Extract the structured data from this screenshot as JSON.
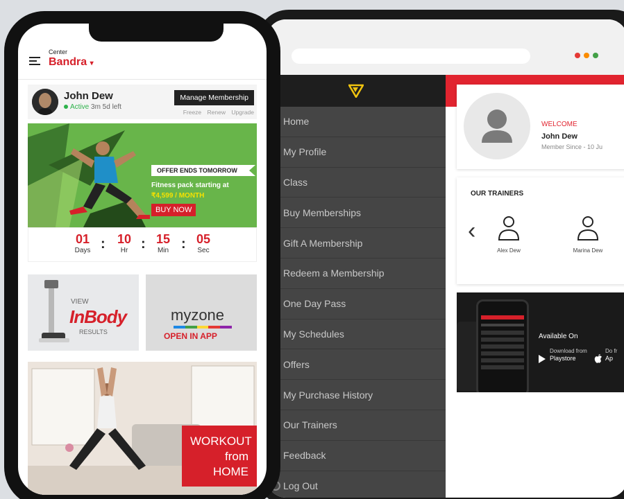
{
  "phone": {
    "center_label": "Center",
    "center_name": "Bandra",
    "caret": "▾",
    "member": {
      "name": "John Dew",
      "status_active": "Active",
      "status_remaining": "3m 5d left",
      "manage_button": "Manage Membership",
      "actions": [
        "Freeze",
        "Renew",
        "Upgrade"
      ]
    },
    "offer": {
      "tag": "OFFER ENDS TOMORROW",
      "line1": "Fitness pack starting at",
      "price": "₹4,599 / MONTH",
      "cta": "BUY NOW"
    },
    "countdown": [
      {
        "value": "01",
        "unit": "Days"
      },
      {
        "value": "10",
        "unit": "Hr"
      },
      {
        "value": "15",
        "unit": "Min"
      },
      {
        "value": "05",
        "unit": "Sec"
      }
    ],
    "countdown_separator": ":",
    "inbody": {
      "view": "VIEW",
      "brand": "InBody",
      "results": "RESULTS"
    },
    "myzone": {
      "brand": "myzone",
      "cta": "OPEN IN APP"
    },
    "workout": {
      "line1": "WORKOUT",
      "line2": "from",
      "line3": "HOME"
    }
  },
  "tablet": {
    "menu": [
      "Home",
      "My Profile",
      "Class",
      "Buy Memberships",
      "Gift A Membership",
      "Redeem a Membership",
      "One Day Pass",
      "My Schedules",
      "Offers",
      "My Purchase History",
      "Our Trainers",
      "Feedback",
      "Log Out"
    ],
    "welcome": {
      "label": "WELCOME",
      "name": "John Dew",
      "since": "Member Since - 10 Ju"
    },
    "trainers": {
      "title": "OUR TRAINERS",
      "prev": "‹",
      "names": [
        "Alex Dew",
        "Marina Dew"
      ]
    },
    "promo": {
      "available": "Available On",
      "playstore_small": "Download from",
      "playstore": "Playstore",
      "appstore_small": "Do fr",
      "appstore": "Ap"
    }
  },
  "colors": {
    "brand_red": "#d6202a",
    "header_red": "#e1242f",
    "active_green": "#2db24a",
    "menu_bg": "#454545",
    "offer_green": "#68b54a",
    "dot_red": "#e53935",
    "dot_orange": "#fb8c00",
    "dot_green": "#43a047"
  },
  "icons": {
    "hamburger": "hamburger-icon",
    "logo": "brand-logo-icon",
    "avatar_placeholder": "user-placeholder-icon",
    "trainer": "user-outline-icon",
    "chevron": "chevron-left-icon",
    "playstore": "play-store-icon",
    "apple": "apple-icon",
    "logout": "logout-icon"
  }
}
